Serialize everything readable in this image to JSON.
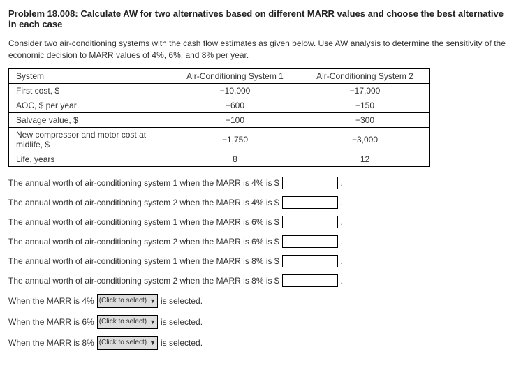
{
  "title": "Problem 18.008: Calculate AW for two alternatives based on different MARR values and choose the best alternative in each case",
  "intro": "Consider two air-conditioning systems with the cash flow estimates as given below. Use AW analysis to determine the sensitivity of the economic decision to MARR values of 4%, 6%, and 8% per year.",
  "table": {
    "h0": "System",
    "h1": "Air-Conditioning System 1",
    "h2": "Air-Conditioning System 2",
    "rows": [
      {
        "l": "First cost, $",
        "a": "−10,000",
        "b": "−17,000"
      },
      {
        "l": "AOC, $ per year",
        "a": "−600",
        "b": "−150"
      },
      {
        "l": "Salvage value, $",
        "a": "−100",
        "b": "−300"
      },
      {
        "l": "New compressor and motor cost at midlife, $",
        "a": "−1,750",
        "b": "−3,000"
      },
      {
        "l": "Life, years",
        "a": "8",
        "b": "12"
      }
    ]
  },
  "questions": [
    "The annual worth of air-conditioning system 1 when the MARR is 4% is $",
    "The annual worth of air-conditioning system 2 when the MARR is 4% is $",
    "The annual worth of air-conditioning system 1 when the MARR is 6% is $",
    "The annual worth of air-conditioning system 2 when the MARR is 6% is $",
    "The annual worth of air-conditioning system 1 when the MARR is 8% is $",
    "The annual worth of air-conditioning system 2 when the MARR is 8% is $"
  ],
  "selects": [
    {
      "pre": "When the MARR is 4%",
      "post": "is selected."
    },
    {
      "pre": "When the MARR is 6%",
      "post": "is selected."
    },
    {
      "pre": "When the MARR is 8%",
      "post": "is selected."
    }
  ],
  "select_placeholder": "(Click to select)",
  "period": "."
}
